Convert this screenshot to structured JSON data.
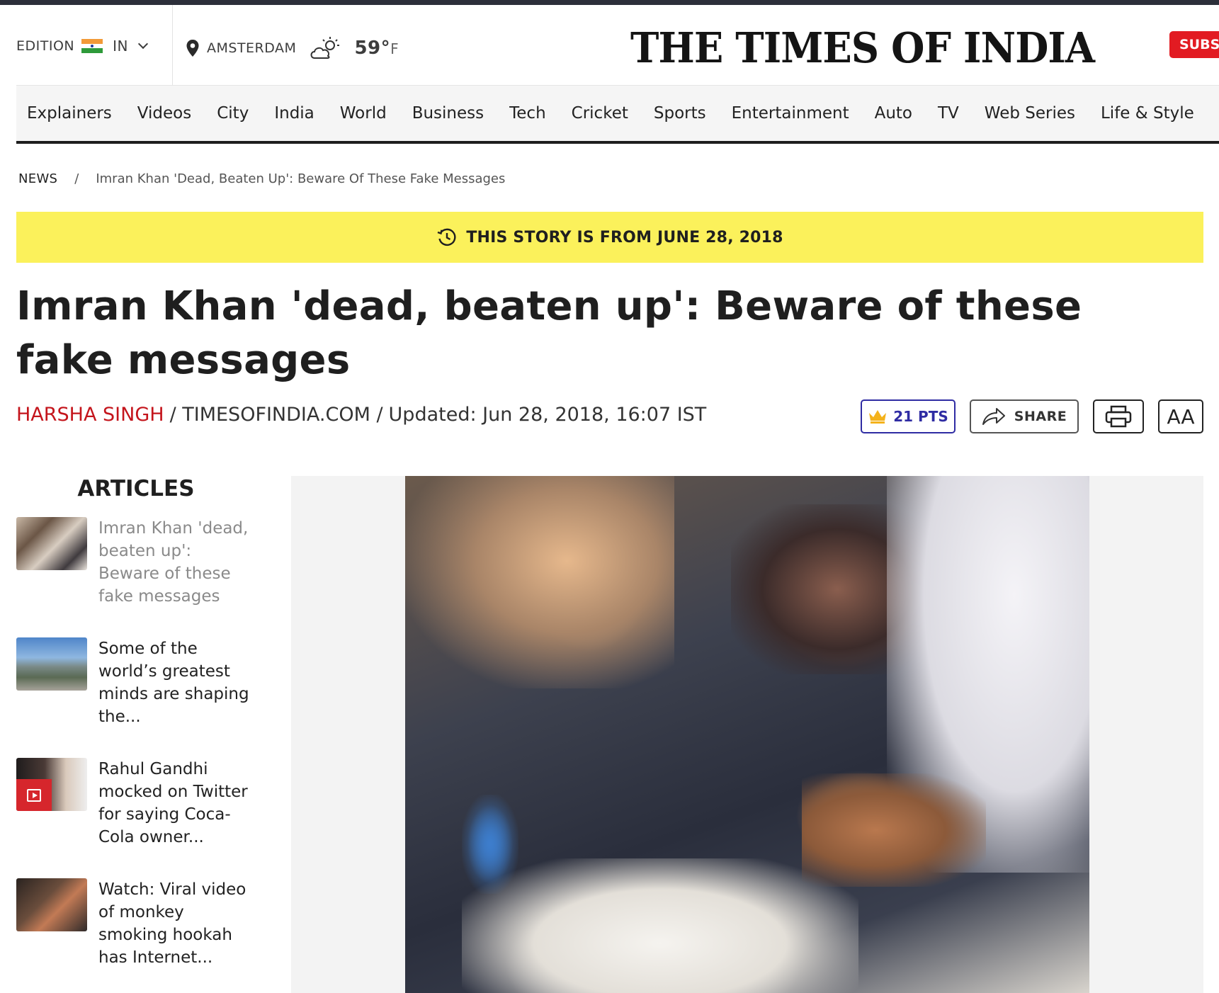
{
  "header": {
    "edition_label": "EDITION",
    "edition_code": "IN",
    "location": "AMSTERDAM",
    "temperature": "59°",
    "temperature_unit": "F",
    "logo": "THE TIMES OF INDIA",
    "subscribe_label": "SUBS",
    "icons": [
      "india-flag-icon",
      "chevron-down-icon",
      "location-pin-icon",
      "partly-cloudy-icon"
    ]
  },
  "nav": {
    "items": [
      "Explainers",
      "Videos",
      "City",
      "India",
      "World",
      "Business",
      "Tech",
      "Cricket",
      "Sports",
      "Entertainment",
      "Auto",
      "TV",
      "Web Series",
      "Life & Style"
    ]
  },
  "breadcrumb": {
    "root": "NEWS",
    "separator": "/",
    "current": "Imran Khan 'Dead, Beaten Up': Beware Of These Fake Messages"
  },
  "banner": {
    "text": "THIS STORY IS FROM JUNE 28, 2018",
    "icon": "history-clock-icon",
    "color": "#fbf15b"
  },
  "article": {
    "headline": "Imran Khan 'dead, beaten up': Beware of these fake messages",
    "author": "HARSHA SINGH",
    "source": "/ TIMESOFINDIA.COM /",
    "updated": "Updated: Jun 28, 2018, 16:07 IST",
    "author_color": "#c4151c"
  },
  "actions": {
    "points_label": "21 PTS",
    "share_label": "SHARE",
    "font_size_label": "AA",
    "icons": [
      "crown-icon",
      "share-arrow-icon",
      "printer-icon"
    ]
  },
  "sidebar": {
    "title": "ARTICLES",
    "items": [
      {
        "title": "Imran Khan 'dead, beaten up': Beware of these fake messages",
        "active": true
      },
      {
        "title": "Some of the world’s greatest minds are shaping the...",
        "active": false
      },
      {
        "title": "Rahul Gandhi mocked on Twitter for saying Coca-Cola owner...",
        "active": false,
        "video": true
      },
      {
        "title": "Watch: Viral video of monkey smoking hookah has Internet...",
        "active": false
      }
    ]
  },
  "colors": {
    "brand_red": "#e21b22",
    "points_blue": "#2f2ca3"
  }
}
